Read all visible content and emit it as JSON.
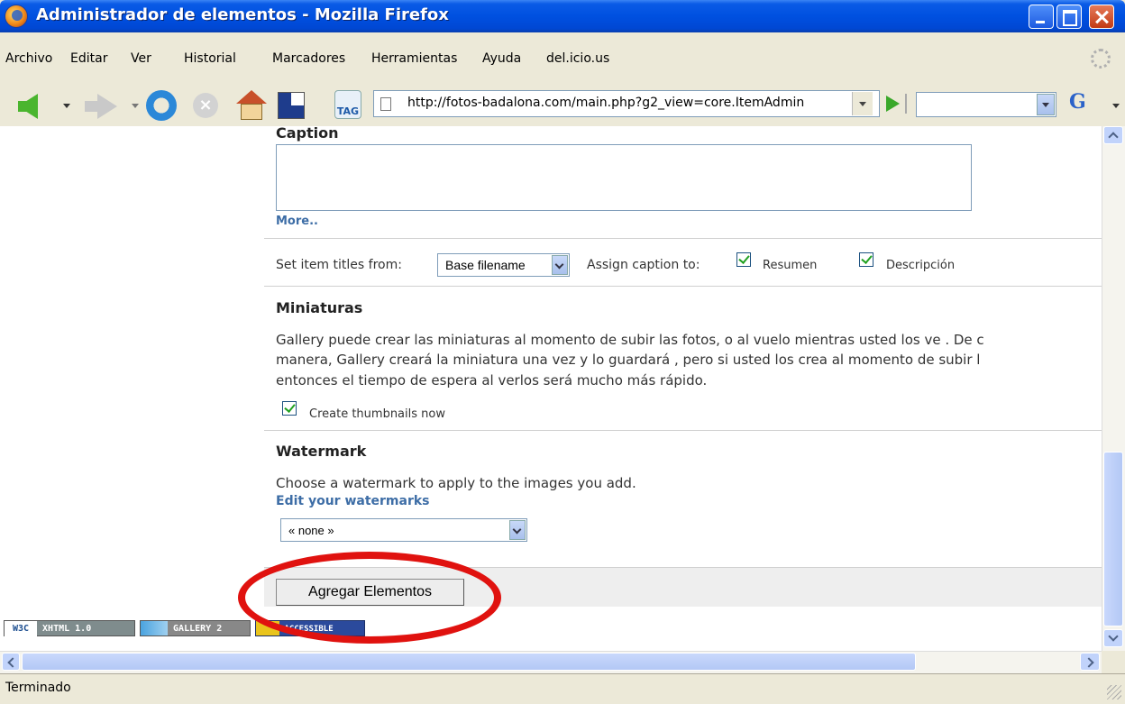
{
  "window": {
    "title": "Administrador de elementos - Mozilla Firefox"
  },
  "menu": {
    "items": [
      "Archivo",
      "Editar",
      "Ver",
      "Historial",
      "Marcadores",
      "Herramientas",
      "Ayuda",
      "del.icio.us"
    ]
  },
  "toolbar": {
    "url": "http://fotos-badalona.com/main.php?g2_view=core.ItemAdmin",
    "tag_label": "TAG",
    "search_engine": "G",
    "icons": [
      "back-icon",
      "forward-icon",
      "reload-icon",
      "stop-icon",
      "home-icon",
      "gallery-icon",
      "tag-icon",
      "go-icon",
      "google-icon"
    ]
  },
  "caption": {
    "heading": "Caption",
    "more_link": "More.."
  },
  "options": {
    "titles_label": "Set item titles from:",
    "titles_value": "Base filename",
    "assign_label": "Assign caption to:",
    "check_resumen": "Resumen",
    "check_descripcion": "Descripción"
  },
  "thumbs": {
    "heading": "Miniaturas",
    "line1": "Gallery puede crear las miniaturas al momento de subir las fotos, o al vuelo mientras usted los ve . De c",
    "line2": "manera, Gallery creará la miniatura una vez y lo guardará , pero si usted los crea al momento de subir l",
    "line3": "entonces el tiempo de espera al verlos será mucho más rápido.",
    "create_now": "Create thumbnails now"
  },
  "watermark": {
    "heading": "Watermark",
    "description": "Choose a watermark to apply to the images you add.",
    "edit_link": "Edit your watermarks",
    "select_value": "« none »"
  },
  "submit": {
    "label": "Agregar Elementos"
  },
  "badges": {
    "w3c": "W3C",
    "xhtml": "XHTML 1.0",
    "gallery": "GALLERY 2",
    "accessible": "ACCESSIBLE"
  },
  "status": {
    "text": "Terminado"
  },
  "colors": {
    "title_bar": "#0050e0",
    "link": "#3d6da6",
    "highlight": "#e0120f",
    "check": "#21a121"
  }
}
